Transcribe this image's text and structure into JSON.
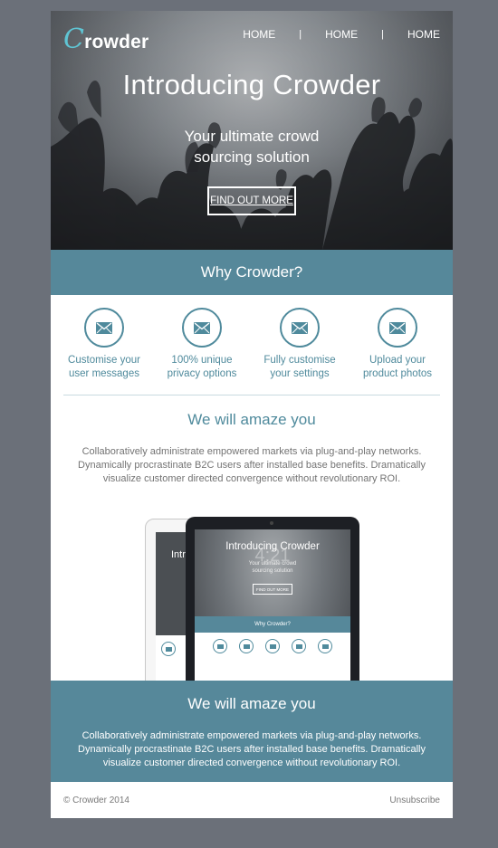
{
  "brand": {
    "logo_first": "C",
    "logo_rest": "rowder"
  },
  "nav": {
    "items": [
      "HOME",
      "HOME",
      "HOME"
    ],
    "separator": "|"
  },
  "hero": {
    "title": "Introducing Crowder",
    "subtitle_line1": "Your ultimate crowd",
    "subtitle_line2": "sourcing solution",
    "button_label": "FIND OUT MORE"
  },
  "why": {
    "title": "Why Crowder?"
  },
  "features": [
    {
      "icon": "envelope-icon",
      "line1": "Customise your",
      "line2": "user messages"
    },
    {
      "icon": "envelope-icon",
      "line1": "100% unique",
      "line2": "privacy options"
    },
    {
      "icon": "envelope-icon",
      "line1": "Fully customise",
      "line2": "your settings"
    },
    {
      "icon": "envelope-icon",
      "line1": "Upload your",
      "line2": "product photos"
    }
  ],
  "amaze_section": {
    "title": "We will amaze you",
    "text": "Collaboratively administrate empowered markets via plug-and-play networks. Dynamically procrastinate B2C users after installed base benefits. Dramatically visualize customer directed convergence without revolutionary ROI."
  },
  "device_preview": {
    "title": "Introducing Crowder",
    "partial_title": "Intr",
    "time": "4:21",
    "subtitle_line1": "Your ultimate crowd",
    "subtitle_line2": "sourcing solution",
    "button_label": "FIND OUT MORE",
    "why_label": "Why Crowder?"
  },
  "amaze_banner": {
    "title": "We will amaze you",
    "text": "Collaboratively administrate empowered markets via plug-and-play networks. Dynamically procrastinate B2C users after installed base benefits. Dramatically visualize customer directed convergence without revolutionary ROI."
  },
  "footer": {
    "copyright": "© Crowder 2014",
    "unsubscribe": "Unsubscribe"
  },
  "colors": {
    "teal": "#56889a",
    "teal_text": "#4f8a9c",
    "logo_accent": "#5fc4d3",
    "background": "#6b7079"
  }
}
